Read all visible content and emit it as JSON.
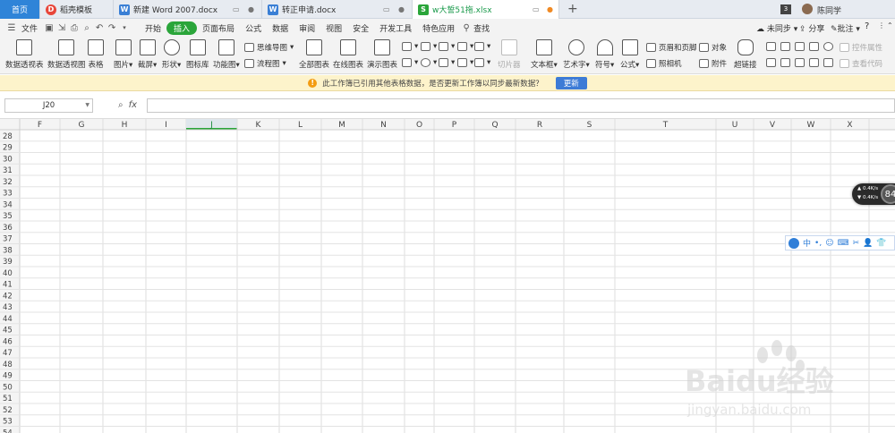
{
  "tabs": [
    {
      "label": "首页",
      "icon": "home-tab",
      "type": "home"
    },
    {
      "label": "稻壳模板",
      "icon": "docer-icon",
      "color": "#e8463a"
    },
    {
      "label": "新建 Word 2007.docx",
      "icon": "word-icon",
      "color": "#3a7fd5"
    },
    {
      "label": "转正申请.docx",
      "icon": "word-icon",
      "color": "#3a7fd5"
    },
    {
      "label": "w大誓51拖.xlsx",
      "icon": "excel-icon",
      "color": "#2aa53a",
      "active": true
    }
  ],
  "tabbar_right": {
    "badge": "3",
    "user": "陈同学"
  },
  "menu": {
    "file": "文件",
    "items": [
      "开始",
      "插入",
      "页面布局",
      "公式",
      "数据",
      "审阅",
      "视图",
      "安全",
      "开发工具",
      "特色应用"
    ],
    "active": "插入",
    "search": "查找",
    "right": {
      "sync": "未同步",
      "share": "分享",
      "comment": "批注"
    }
  },
  "ribbon": {
    "large": [
      "数据透视表",
      "数据透视图",
      "表格",
      "图片",
      "截屏",
      "形状",
      "图标库",
      "功能图",
      "全部图表",
      "在线图表",
      "演示图表",
      "切片器",
      "文本框",
      "艺术字",
      "符号",
      "公式",
      "超链接"
    ],
    "small": {
      "mindmap": "思维导图",
      "flowchart": "流程图",
      "header_footer": "页眉和页脚",
      "object": "对象",
      "camera": "照相机",
      "attachment": "附件",
      "control_props": "控件属性",
      "view_code": "查看代码"
    }
  },
  "notice": {
    "text": "此工作簿已引用其他表格数据，是否更新工作簿以同步最新数据？",
    "button": "更新"
  },
  "formula": {
    "namebox": "J20",
    "fx": "fx",
    "value": ""
  },
  "sheet": {
    "columns": [
      "F",
      "G",
      "H",
      "I",
      "J",
      "K",
      "L",
      "M",
      "N",
      "O",
      "P",
      "Q",
      "R",
      "S",
      "T",
      "U",
      "V",
      "W",
      "X",
      "Y"
    ],
    "selected_column": "J",
    "rows": [
      28,
      29,
      30,
      31,
      32,
      33,
      34,
      35,
      36,
      37,
      38,
      39,
      40,
      41,
      42,
      43,
      44,
      45,
      46,
      47,
      48,
      49,
      50,
      51,
      52,
      53,
      54
    ]
  },
  "widgets": {
    "speed_up": "0.4K/s",
    "speed_down": "0.4K/s",
    "ball": "84",
    "ime": "中"
  },
  "watermark": {
    "brand": "Baidu经验",
    "url": "jingyan.baidu.com"
  }
}
